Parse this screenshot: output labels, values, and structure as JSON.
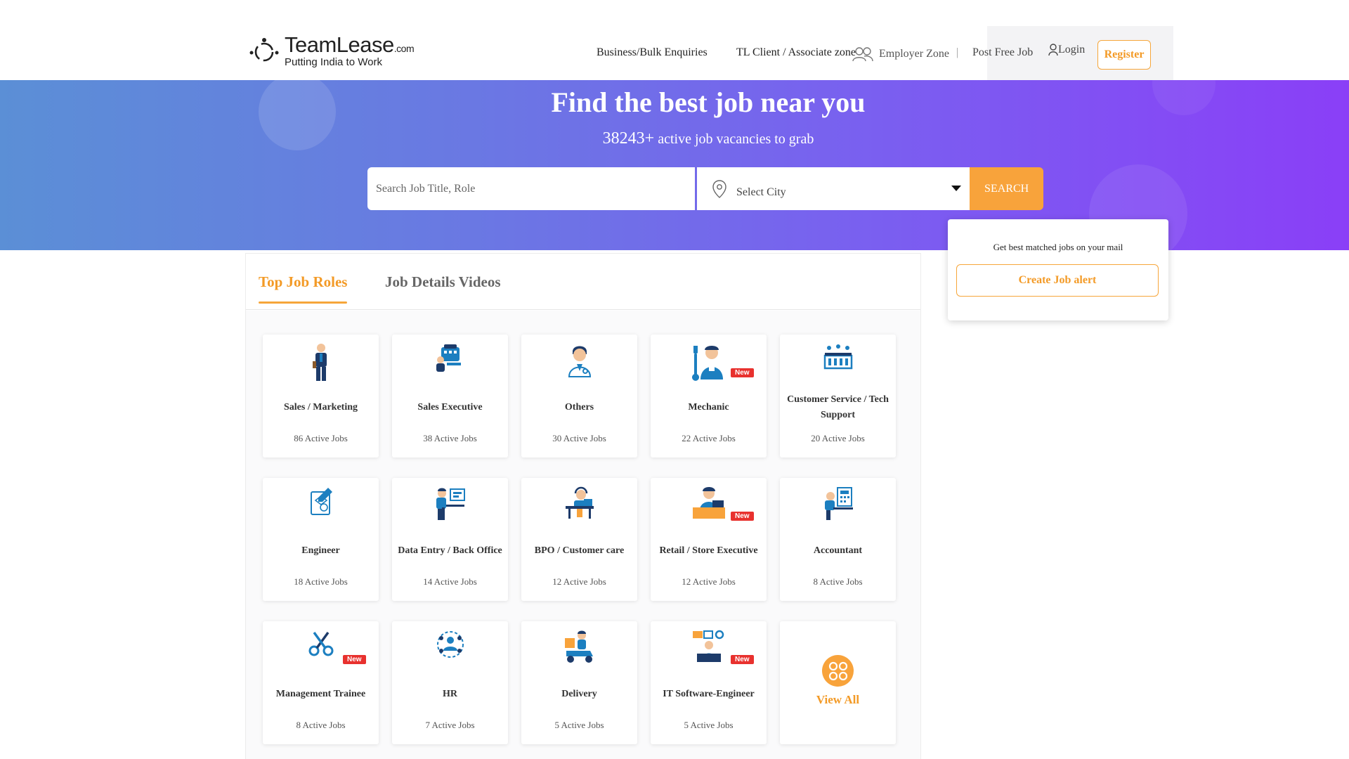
{
  "header": {
    "logo_name": "TeamLease",
    "logo_domain": ".com",
    "logo_tagline": "Putting India to Work",
    "nav": {
      "business": "Business/Bulk Enquiries",
      "tl_client": "TL Client / Associate zone",
      "employer": "Employer Zone",
      "separator": "|",
      "post_job": "Post Free Job",
      "login": "Login",
      "register": "Register"
    }
  },
  "hero": {
    "title": "Find the best job near you",
    "vacancy_count": "38243+",
    "vacancy_text": " active job vacancies to grab",
    "search_placeholder": "Search Job Title, Role",
    "city_label": "Select City",
    "search_button": "SEARCH"
  },
  "job_alert": {
    "text": "Get best matched jobs on your mail",
    "button": "Create Job alert"
  },
  "tabs": {
    "active": "Top Job Roles",
    "inactive": "Job Details Videos"
  },
  "job_roles": [
    {
      "title": "Sales / Marketing",
      "count": "86 Active Jobs",
      "icon": "salesman-icon",
      "new": false
    },
    {
      "title": "Sales Executive",
      "count": "38 Active Jobs",
      "icon": "sales-executive-icon",
      "new": false
    },
    {
      "title": "Others",
      "count": "30 Active Jobs",
      "icon": "doctor-icon",
      "new": false
    },
    {
      "title": "Mechanic",
      "count": "22 Active Jobs",
      "icon": "mechanic-icon",
      "new": true
    },
    {
      "title": "Customer Service / Tech Support",
      "count": "20 Active Jobs",
      "icon": "support-icon",
      "new": false
    },
    {
      "title": "Engineer",
      "count": "18 Active Jobs",
      "icon": "engineer-icon",
      "new": false
    },
    {
      "title": "Data Entry / Back Office",
      "count": "14 Active Jobs",
      "icon": "data-entry-icon",
      "new": false
    },
    {
      "title": "BPO / Customer care",
      "count": "12 Active Jobs",
      "icon": "bpo-icon",
      "new": false
    },
    {
      "title": "Retail / Store Executive",
      "count": "12 Active Jobs",
      "icon": "retail-icon",
      "new": true
    },
    {
      "title": "Accountant",
      "count": "8 Active Jobs",
      "icon": "accountant-icon",
      "new": false
    },
    {
      "title": "Management Trainee",
      "count": "8 Active Jobs",
      "icon": "trainee-icon",
      "new": true
    },
    {
      "title": "HR",
      "count": "7 Active Jobs",
      "icon": "hr-icon",
      "new": false
    },
    {
      "title": "Delivery",
      "count": "5 Active Jobs",
      "icon": "delivery-scooter-icon",
      "new": false
    },
    {
      "title": "IT Software-Engineer",
      "count": "5 Active Jobs",
      "icon": "it-engineer-icon",
      "new": true
    }
  ],
  "badge_text": "New",
  "view_all": "View All",
  "colors": {
    "accent_orange": "#f39a26",
    "badge_red": "#e8312e",
    "hero_start": "#5b8fd6",
    "hero_end": "#8a3ff7",
    "icon_blue": "#1c7fc0"
  }
}
